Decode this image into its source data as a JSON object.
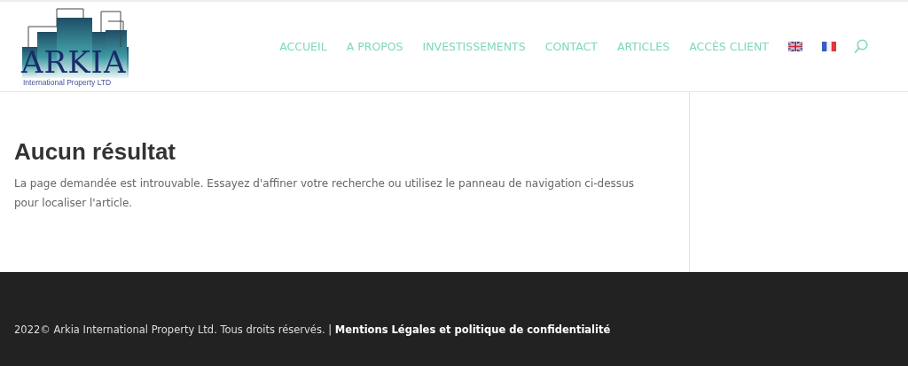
{
  "logo": {
    "name": "ARKIA",
    "tagline": "International Property LTD"
  },
  "nav": [
    {
      "kind": "link",
      "label": "ACCUEIL"
    },
    {
      "kind": "link",
      "label": "A PROPOS"
    },
    {
      "kind": "link",
      "label": "INVESTISSEMENTS"
    },
    {
      "kind": "link",
      "label": "CONTACT"
    },
    {
      "kind": "link",
      "label": "ARTICLES"
    },
    {
      "kind": "link",
      "label": "ACCÈS CLIENT"
    },
    {
      "kind": "flag-uk"
    },
    {
      "kind": "flag-fr"
    },
    {
      "kind": "search"
    }
  ],
  "content": {
    "heading": "Aucun résultat",
    "text": "La page demandée est introuvable. Essayez d'affiner votre recherche ou utilisez le panneau de navigation ci-dessus pour localiser l'article."
  },
  "footer": {
    "text": "2022© Arkia International Property Ltd. Tous droits réservés. | ",
    "link": "Mentions Légales et politique de confidentialité"
  }
}
